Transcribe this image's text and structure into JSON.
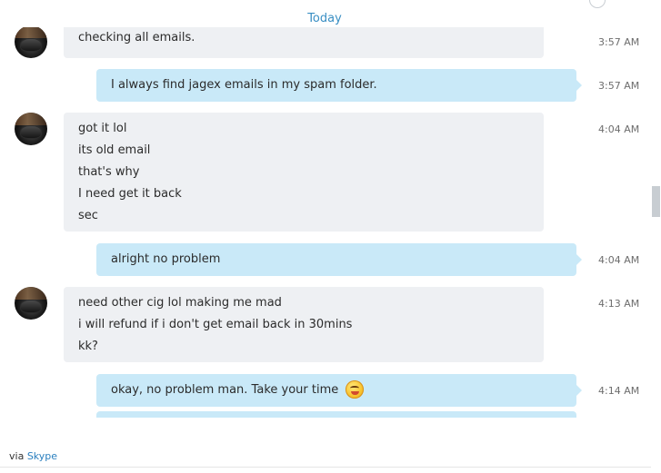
{
  "header": {
    "day": "Today"
  },
  "messages": [
    {
      "lines": [
        "checking all emails."
      ],
      "time": "3:57 AM"
    },
    {
      "lines": [
        "I always find jagex emails in my spam folder."
      ],
      "time": "3:57 AM"
    },
    {
      "lines": [
        "got it lol",
        "its old email",
        "that's why",
        "I need get it back",
        "sec"
      ],
      "time": "4:04 AM"
    },
    {
      "lines": [
        "alright no problem"
      ],
      "time": "4:04 AM"
    },
    {
      "lines": [
        "need other cig lol making me mad",
        "i will refund if i don't get email back in 30mins",
        "kk?"
      ],
      "time": "4:13 AM"
    },
    {
      "lines": [
        "okay, no problem man. Take your time"
      ],
      "emoji": "smiling-emoji",
      "time": "4:14 AM"
    }
  ],
  "footer": {
    "via": "via",
    "link": "Skype"
  }
}
